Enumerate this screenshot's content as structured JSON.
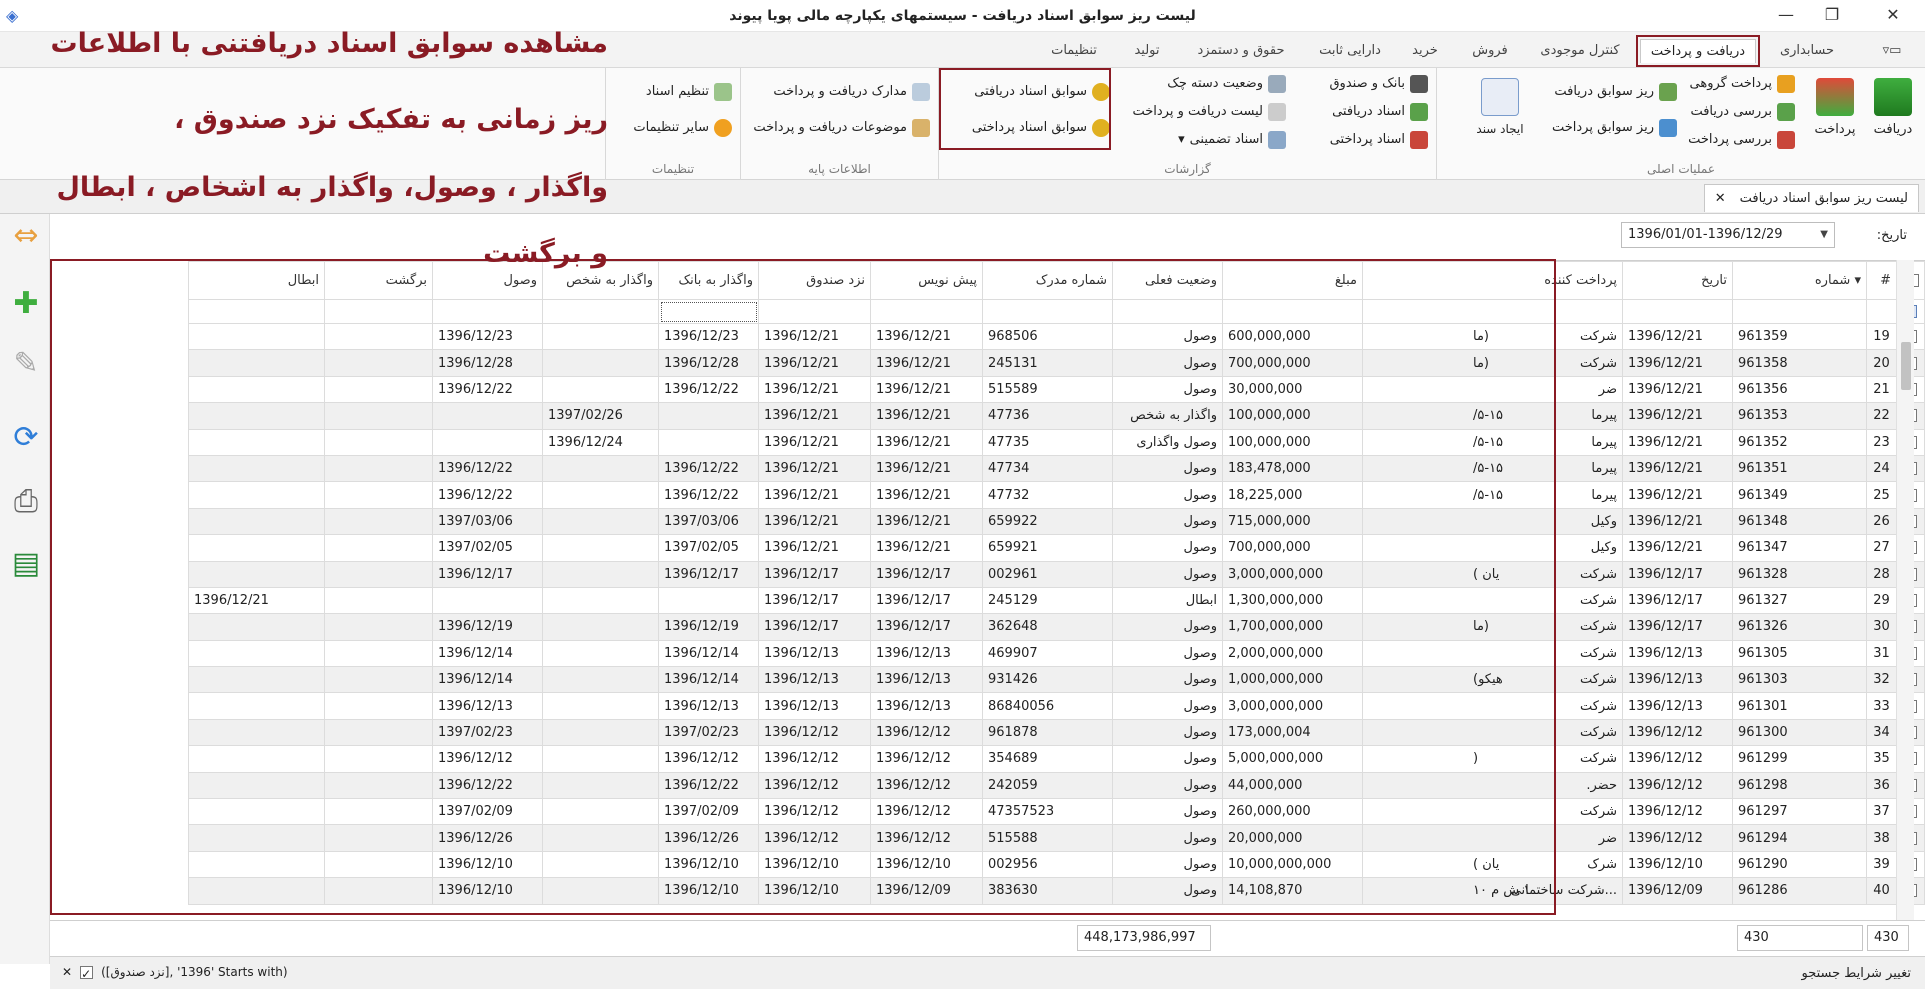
{
  "window": {
    "title": "لیست ریز سوابق اسناد دریافت - سیستمهای یکپارچه مالی پویا پیوند",
    "minimize": "—",
    "maximize": "❐",
    "close": "✕"
  },
  "menu_tabs": [
    "حسابداری",
    "دریافت و پرداخت",
    "کنترل موجودی",
    "فروش",
    "خرید",
    "دارایی ثابت",
    "حقوق و دستمزد",
    "تولید",
    "تنظیمات"
  ],
  "ribbon": {
    "main_ops": {
      "label": "عملیات اصلی",
      "big": [
        "دریافت",
        "پرداخت"
      ],
      "small": [
        "پرداخت گروهی",
        "بررسی دریافت",
        "بررسی پرداخت"
      ],
      "list": [
        "ریز سوابق دریافت",
        "ریز سوابق پرداخت"
      ],
      "create": "ایجاد سند"
    },
    "reports": {
      "label": "گزارشات",
      "col1": [
        "بانک و صندوق",
        "اسناد دریافتی",
        "اسناد پرداختی"
      ],
      "col2": [
        "وضعیت دسته چک",
        "لیست دریافت و پرداخت",
        "اسناد تضمینی"
      ],
      "col3": [
        "سوابق اسناد دریافتی",
        "سوابق اسناد پرداختی"
      ]
    },
    "base": {
      "label": "اطلاعات پایه",
      "items": [
        "مدارک دریافت و پرداخت",
        "موضوعات دریافت و پرداخت"
      ]
    },
    "settings": {
      "label": "تنظیمات",
      "items": [
        "تنظیم اسناد",
        "سایر تنظیمات"
      ]
    }
  },
  "annotation": {
    "line1": "مشاهده سوابق اسناد دریافتنی  با اطلاعات",
    "line2": "ریز زمانی به تفکیک  نزد صندوق ،",
    "line3": "واگذار ، وصول، واگذار به اشخاص ، ابطال",
    "line4": "و برگشت"
  },
  "doc_tab": {
    "label": "لیست ریز سوابق اسناد دریافت",
    "close": "✕"
  },
  "filter": {
    "date_label": "تاریخ:",
    "date_value": "1396/01/01-1396/12/29"
  },
  "columns": [
    "#",
    "شماره",
    "تاریخ",
    "پرداخت کننده",
    "مبلغ",
    "وضعیت فعلی",
    "شماره مدرک",
    "پیش نویس",
    "نزد صندوق",
    "واگذار به بانک",
    "واگذار به شخص",
    "وصول",
    "برگشت",
    "ابطال"
  ],
  "rows": [
    [
      "19",
      "961359",
      "1396/12/21",
      "شرکت",
      "(ما",
      "600,000,000",
      "وصول",
      "968506",
      "1396/12/21",
      "1396/12/21",
      "1396/12/23",
      "",
      "1396/12/23",
      "",
      ""
    ],
    [
      "20",
      "961358",
      "1396/12/21",
      "شرکت",
      "(ما",
      "700,000,000",
      "وصول",
      "245131",
      "1396/12/21",
      "1396/12/21",
      "1396/12/28",
      "",
      "1396/12/28",
      "",
      ""
    ],
    [
      "21",
      "961356",
      "1396/12/21",
      "ضر",
      "",
      "30,000,000",
      "وصول",
      "515589",
      "1396/12/21",
      "1396/12/21",
      "1396/12/22",
      "",
      "1396/12/22",
      "",
      ""
    ],
    [
      "22",
      "961353",
      "1396/12/21",
      "پیرما",
      "۵-۱۵/",
      "100,000,000",
      "واگذار به شخص",
      "47736",
      "1396/12/21",
      "1396/12/21",
      "",
      "1397/02/26",
      "",
      "",
      ""
    ],
    [
      "23",
      "961352",
      "1396/12/21",
      "پیرما",
      "۵-۱۵/",
      "100,000,000",
      "وصول واگذاری",
      "47735",
      "1396/12/21",
      "1396/12/21",
      "",
      "1396/12/24",
      "",
      "",
      ""
    ],
    [
      "24",
      "961351",
      "1396/12/21",
      "پیرما",
      "۵-۱۵/",
      "183,478,000",
      "وصول",
      "47734",
      "1396/12/21",
      "1396/12/21",
      "1396/12/22",
      "",
      "1396/12/22",
      "",
      ""
    ],
    [
      "25",
      "961349",
      "1396/12/21",
      "پیرما",
      "۵-۱۵/",
      "18,225,000",
      "وصول",
      "47732",
      "1396/12/21",
      "1396/12/21",
      "1396/12/22",
      "",
      "1396/12/22",
      "",
      ""
    ],
    [
      "26",
      "961348",
      "1396/12/21",
      "وکیل",
      "",
      "715,000,000",
      "وصول",
      "659922",
      "1396/12/21",
      "1396/12/21",
      "1397/03/06",
      "",
      "1397/03/06",
      "",
      ""
    ],
    [
      "27",
      "961347",
      "1396/12/21",
      "وکیل",
      "",
      "700,000,000",
      "وصول",
      "659921",
      "1396/12/21",
      "1396/12/21",
      "1397/02/05",
      "",
      "1397/02/05",
      "",
      ""
    ],
    [
      "28",
      "961328",
      "1396/12/17",
      "شرکت",
      "یان )",
      "3,000,000,000",
      "وصول",
      "002961",
      "1396/12/17",
      "1396/12/17",
      "1396/12/17",
      "",
      "1396/12/17",
      "",
      ""
    ],
    [
      "29",
      "961327",
      "1396/12/17",
      "شرکت",
      "",
      "1,300,000,000",
      "ابطال",
      "245129",
      "1396/12/17",
      "1396/12/17",
      "",
      "",
      "",
      "",
      "1396/12/21"
    ],
    [
      "30",
      "961326",
      "1396/12/17",
      "شرکت",
      "(ما",
      "1,700,000,000",
      "وصول",
      "362648",
      "1396/12/17",
      "1396/12/17",
      "1396/12/19",
      "",
      "1396/12/19",
      "",
      ""
    ],
    [
      "31",
      "961305",
      "1396/12/13",
      "شرکت",
      "",
      "2,000,000,000",
      "وصول",
      "469907",
      "1396/12/13",
      "1396/12/13",
      "1396/12/14",
      "",
      "1396/12/14",
      "",
      ""
    ],
    [
      "32",
      "961303",
      "1396/12/13",
      "شرکت",
      "هیکو)",
      "1,000,000,000",
      "وصول",
      "931426",
      "1396/12/13",
      "1396/12/13",
      "1396/12/14",
      "",
      "1396/12/14",
      "",
      ""
    ],
    [
      "33",
      "961301",
      "1396/12/13",
      "شرکت",
      "",
      "3,000,000,000",
      "وصول",
      "86840056",
      "1396/12/13",
      "1396/12/13",
      "1396/12/13",
      "",
      "1396/12/13",
      "",
      ""
    ],
    [
      "34",
      "961300",
      "1396/12/12",
      "شرکت",
      "",
      "173,000,004",
      "وصول",
      "961878",
      "1396/12/12",
      "1396/12/12",
      "1397/02/23",
      "",
      "1397/02/23",
      "",
      ""
    ],
    [
      "35",
      "961299",
      "1396/12/12",
      "شرکت",
      "(",
      "5,000,000,000",
      "وصول",
      "354689",
      "1396/12/12",
      "1396/12/12",
      "1396/12/12",
      "",
      "1396/12/12",
      "",
      ""
    ],
    [
      "36",
      "961298",
      "1396/12/12",
      "حضر.",
      "",
      "44,000,000",
      "وصول",
      "242059",
      "1396/12/12",
      "1396/12/12",
      "1396/12/22",
      "",
      "1396/12/22",
      "",
      ""
    ],
    [
      "37",
      "961297",
      "1396/12/12",
      "شرکت",
      "",
      "260,000,000",
      "وصول",
      "47357523",
      "1396/12/12",
      "1396/12/12",
      "1397/02/09",
      "",
      "1397/02/09",
      "",
      ""
    ],
    [
      "38",
      "961294",
      "1396/12/12",
      "ضر",
      "",
      "20,000,000",
      "وصول",
      "515588",
      "1396/12/12",
      "1396/12/12",
      "1396/12/26",
      "",
      "1396/12/26",
      "",
      ""
    ],
    [
      "39",
      "961290",
      "1396/12/10",
      "شرک",
      "یان )",
      "10,000,000,000",
      "وصول",
      "002956",
      "1396/12/10",
      "1396/12/10",
      "1396/12/10",
      "",
      "1396/12/10",
      "",
      ""
    ],
    [
      "40",
      "961286",
      "1396/12/09",
      "...شرکت ساختمانی",
      "۱ ش م ۱۰",
      "14,108,870",
      "وصول",
      "383630",
      "1396/12/09",
      "1396/12/10",
      "1396/12/10",
      "",
      "1396/12/10",
      "",
      ""
    ]
  ],
  "summary": {
    "count_a": "430",
    "count_b": "430",
    "total": "448,173,986,997"
  },
  "status": {
    "criteria": "تغییر شرایط جستجو",
    "filter_text": "([نزد صندوق], '1396' Starts with)",
    "filter_close": "✕"
  },
  "colors": {
    "accent": "#8a1b24",
    "tab_active_outline": "#8a1b24",
    "alt_row": "#f0f0f0"
  }
}
